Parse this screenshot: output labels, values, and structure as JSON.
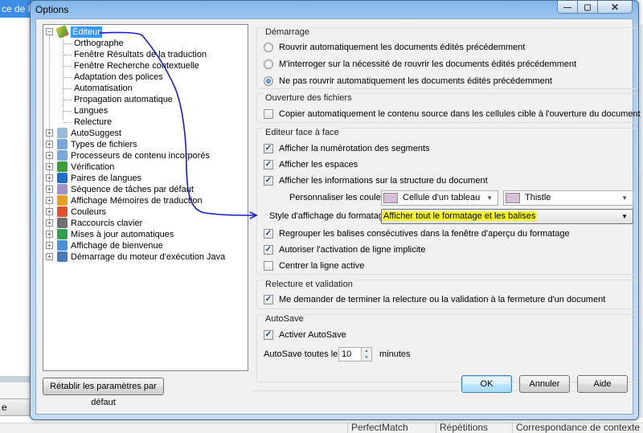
{
  "background": {
    "app_title_fragment": "ce de Pr",
    "tab_fragment": "e",
    "footer_columns": [
      "PerfectMatch",
      "Répétitions",
      "Correspondance de contexte"
    ]
  },
  "dialog": {
    "title": "Options",
    "window_controls": {
      "minimize": "—",
      "maximize": "▢",
      "close": "✕"
    }
  },
  "tree": {
    "root": {
      "label": "Éditeur",
      "expanded": true,
      "selected": true
    },
    "children": [
      "Orthographe",
      "Fenêtre Résultats de la traduction",
      "Fenêtre Recherche contextuelle",
      "Adaptation des polices",
      "Automatisation",
      "Propagation automatique",
      "Langues",
      "Relecture"
    ],
    "top_items": [
      {
        "label": "AutoSuggest",
        "icon": "cube-icon",
        "color": "#9ab8d8"
      },
      {
        "label": "Types de fichiers",
        "icon": "file-types-icon",
        "color": "#7aa7d8"
      },
      {
        "label": "Processeurs de contenu incorporés",
        "icon": "embedded-processors-icon",
        "color": "#7aa7d8"
      },
      {
        "label": "Vérification",
        "icon": "verification-icon",
        "color": "#3a9c3a"
      },
      {
        "label": "Paires de langues",
        "icon": "language-pairs-icon",
        "color": "#1e6fc8"
      },
      {
        "label": "Séquence de tâches par défaut",
        "icon": "gear-icon",
        "color": "#a090c8"
      },
      {
        "label": "Affichage Mémoires de traduction",
        "icon": "translation-memory-icon",
        "color": "#e8a020"
      },
      {
        "label": "Couleurs",
        "icon": "colors-icon",
        "color": "#e05030"
      },
      {
        "label": "Raccourcis clavier",
        "icon": "keyboard-icon",
        "color": "#707070"
      },
      {
        "label": "Mises à jour automatiques",
        "icon": "globe-update-icon",
        "color": "#30a050"
      },
      {
        "label": "Affichage de bienvenue",
        "icon": "welcome-icon",
        "color": "#4a90d8"
      },
      {
        "label": "Démarrage du moteur d'exécution Java",
        "icon": "java-icon",
        "color": "#4a7ab8"
      }
    ]
  },
  "sections": {
    "startup": {
      "title": "Démarrage",
      "options": [
        {
          "label": "Rouvrir automatiquement les documents édités précédemment",
          "selected": false
        },
        {
          "label": "M'interroger sur la nécessité de rouvrir les documents édités précédemment",
          "selected": false
        },
        {
          "label": "Ne pas rouvrir automatiquement les documents édités précédemment",
          "selected": true
        }
      ]
    },
    "file_open": {
      "title": "Ouverture des fichiers",
      "options": [
        {
          "label": "Copier automatiquement le contenu source dans les cellules cible à l'ouverture du document",
          "checked": false
        }
      ]
    },
    "editor": {
      "title": "Editeur face à face",
      "options": [
        {
          "label": "Afficher la numérotation des segments",
          "checked": true
        },
        {
          "label": "Afficher les espaces",
          "checked": true
        },
        {
          "label": "Afficher les informations sur la structure du document",
          "checked": true
        }
      ],
      "colors_label": "Personnaliser les couleurs :",
      "colors_element": "Cellule d'un tableau",
      "colors_value": "Thistle",
      "swatch_color": "#d8bfd8",
      "format_label": "Style d'affichage du formatage :",
      "format_value": "Afficher tout le formatage et les balises",
      "options2": [
        {
          "label": "Regrouper les balises consécutives dans la fenêtre d'aperçu du formatage",
          "checked": true
        },
        {
          "label": "Autoriser l'activation de ligne implicite",
          "checked": true
        },
        {
          "label": "Centrer la ligne active",
          "checked": false
        }
      ]
    },
    "review": {
      "title": "Relecture et validation",
      "options": [
        {
          "label": "Me demander de terminer la relecture ou la validation à la fermeture d'un document",
          "checked": true
        }
      ]
    },
    "autosave": {
      "title": "AutoSave",
      "options": [
        {
          "label": "Activer AutoSave",
          "checked": true
        }
      ],
      "interval_label": "AutoSave toutes les",
      "interval_value": "10",
      "interval_unit": "minutes"
    }
  },
  "buttons": {
    "reset": "Rétablir les paramètres par défaut",
    "ok": "OK",
    "cancel": "Annuler",
    "help": "Aide"
  },
  "annotation": {
    "arrow_color": "#1a1ad0",
    "highlight_color": "#f5f52a"
  }
}
